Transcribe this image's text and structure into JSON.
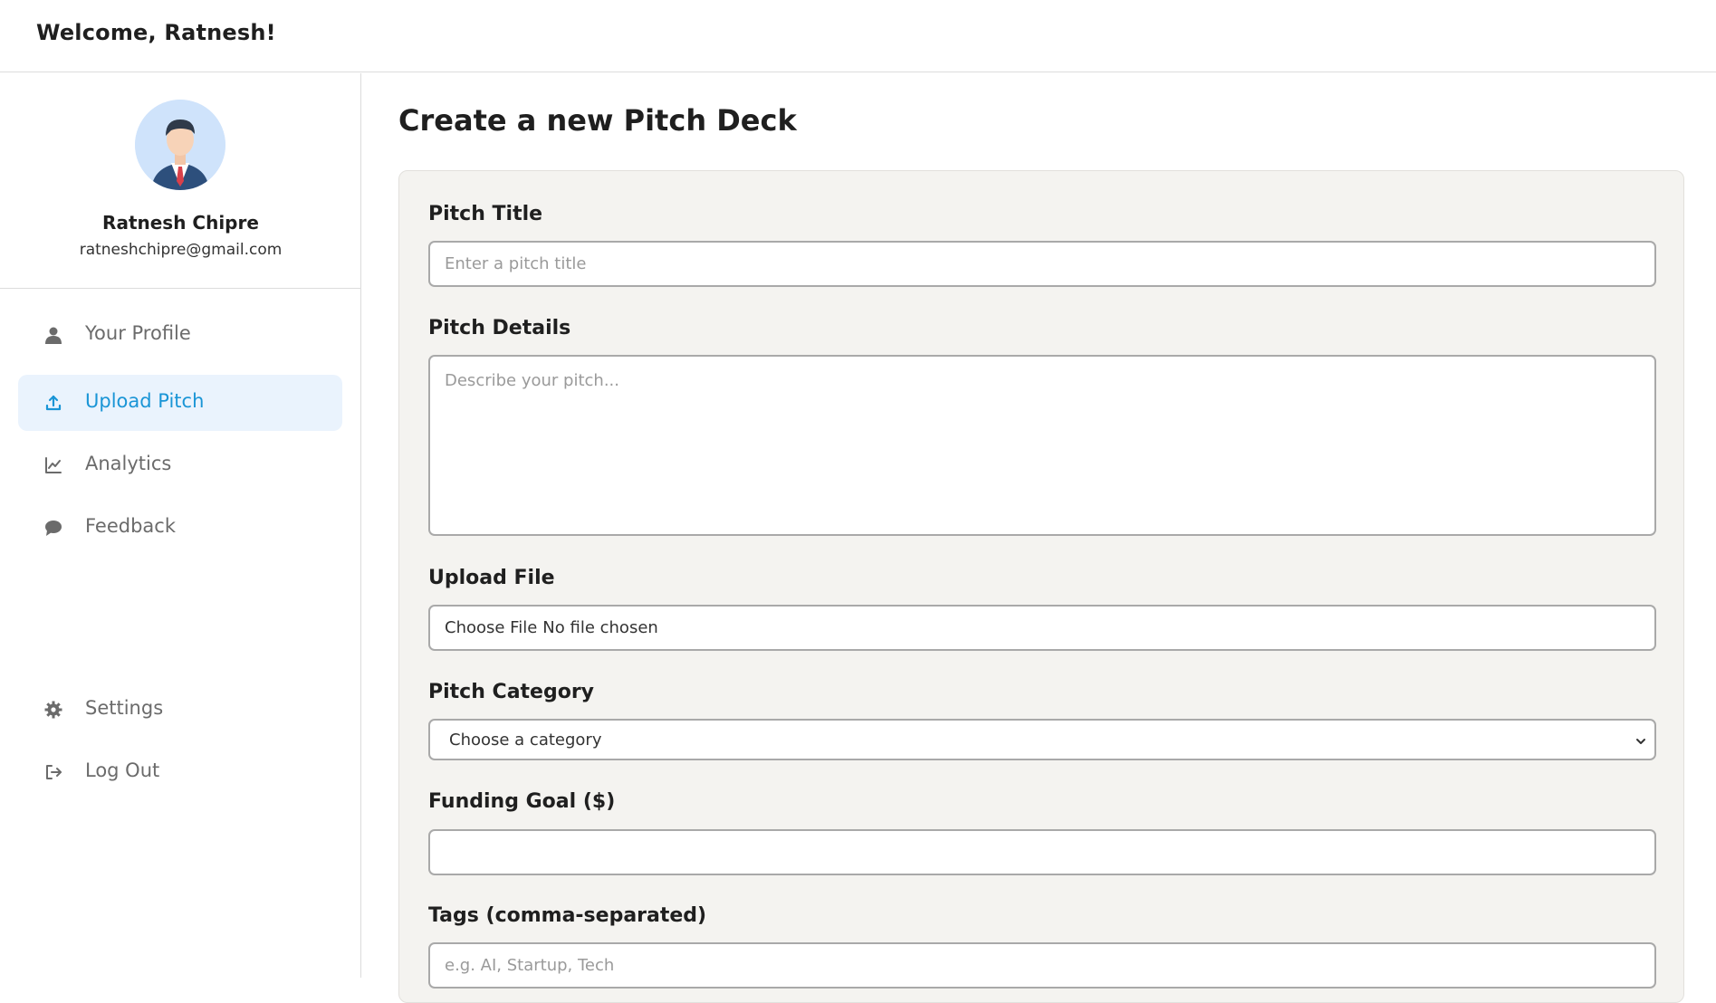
{
  "header": {
    "welcome": "Welcome, Ratnesh!"
  },
  "profile": {
    "name": "Ratnesh Chipre",
    "email": "ratneshchipre@gmail.com",
    "avatar_icon": "businessman-avatar-icon"
  },
  "nav": {
    "items": [
      {
        "label": "Your Profile",
        "icon": "user-icon",
        "active": false
      },
      {
        "label": "Upload Pitch",
        "icon": "upload-icon",
        "active": true
      },
      {
        "label": "Analytics",
        "icon": "chart-line-icon",
        "active": false
      },
      {
        "label": "Feedback",
        "icon": "chat-bubble-icon",
        "active": false
      }
    ],
    "bottom": [
      {
        "label": "Settings",
        "icon": "gear-icon"
      },
      {
        "label": "Log Out",
        "icon": "logout-icon"
      }
    ]
  },
  "main": {
    "title": "Create a new Pitch Deck",
    "form": {
      "pitch_title": {
        "label": "Pitch Title",
        "placeholder": "Enter a pitch title"
      },
      "pitch_details": {
        "label": "Pitch Details",
        "placeholder": "Describe your pitch..."
      },
      "upload_file": {
        "label": "Upload File",
        "button": "Choose File",
        "status": "No file chosen"
      },
      "pitch_category": {
        "label": "Pitch Category",
        "selected": "Choose a category"
      },
      "funding_goal": {
        "label": "Funding Goal ($)",
        "value": ""
      },
      "tags": {
        "label": "Tags (comma-separated)",
        "placeholder": "e.g. AI, Startup, Tech"
      }
    }
  },
  "colors": {
    "accent": "#1a95d6",
    "active_bg": "#eaf3fd",
    "card_bg": "#f4f3f0"
  }
}
